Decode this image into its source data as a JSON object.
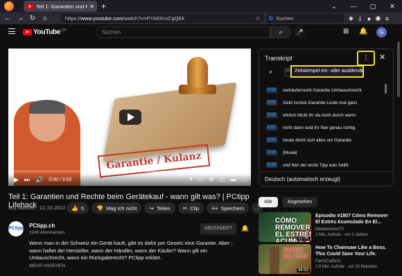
{
  "browser": {
    "tab_title": "Teil 1: Garantien und Rechte be",
    "new_tab": "+",
    "url_prefix": "https://",
    "url_host": "www.youtube.com",
    "url_path": "/watch?v=PYAEKmCgQEk",
    "search_placeholder": "Suchen"
  },
  "youtube": {
    "logo": "YouTube",
    "region": "CH",
    "search_placeholder": "Suchen",
    "avatar_letter": "G"
  },
  "player": {
    "stamp_text": "Garantie / Kulanz",
    "time": "0:00 / 3:50",
    "progress": 0.0
  },
  "video": {
    "title": "Teil 1: Garantien und Rechte beim Gerätekauf - wann gilt was? | PCtipp Lifehack",
    "views": "501 Aufrufe · 12.10.2022",
    "likes": "5",
    "dislike": "Mag ich nicht",
    "share": "Teilen",
    "clip": "Clip",
    "save": "Speichern",
    "more": "···"
  },
  "channel": {
    "name": "PCtipp.ch",
    "avatar_text": "PCtipp",
    "subscribers": "1240 Abonnenten",
    "subscribe": "ABONNIERT",
    "description": "Wenn man in der Schweiz ein Gerät kauft, gibt es dafür per Gesetz eine Garantie. Aber - wann haftet der Hersteller, wann der Händler, wann der Käufer? Wann gilt ein Umtauschrecht, wann ein Rückgaberecht? PCtipp erklärt.",
    "more": "MEHR ANSEHEN"
  },
  "transcript": {
    "title": "Transkript",
    "tooltip": "Zeitstempel ein- oder ausblenden",
    "search_partial": "Im",
    "lines": [
      {
        "ts": "0:00",
        "text": "verkäuferrecht Garantie Umtauschrecht"
      },
      {
        "ts": "0:03",
        "text": "Geld zurück Garantie Leute mal ganz"
      },
      {
        "ts": "0:06",
        "text": "ehrlich blickt ihr da noch durch wenn"
      },
      {
        "ts": "0:07",
        "text": "nicht dann seid ihr hier genau richtig"
      },
      {
        "ts": "0:10",
        "text": "heute dreht sich alles um Garantie"
      },
      {
        "ts": "0:14",
        "text": "[Musik]"
      },
      {
        "ts": "0:29",
        "text": "und hier der erste Tipp was heißt"
      }
    ],
    "language": "Deutsch (automatisch erzeugt)"
  },
  "chips": [
    {
      "label": "Alle",
      "active": true
    },
    {
      "label": "Angesehen",
      "active": false
    }
  ],
  "recommendations": [
    {
      "thumb_text": "CÓMO REMOVER EL ESTRÉS ACUMULADO",
      "duration": "12:16",
      "title": "Episodio #1807 Cómo Remover El Estrés Acumulado En El...",
      "channel": "MetabolismoTV",
      "meta": "2 Mio. Aufrufe · vor 3 Jahren"
    },
    {
      "thumb_text": "NEVER DO THIS!",
      "duration": "44:53",
      "title": "How To Chainsaw Like a Boss. This Could Save Your Life.",
      "channel": "FarmCraft101",
      "meta": "2.6 Mio. Aufrufe · vor 10 Monaten"
    }
  ]
}
